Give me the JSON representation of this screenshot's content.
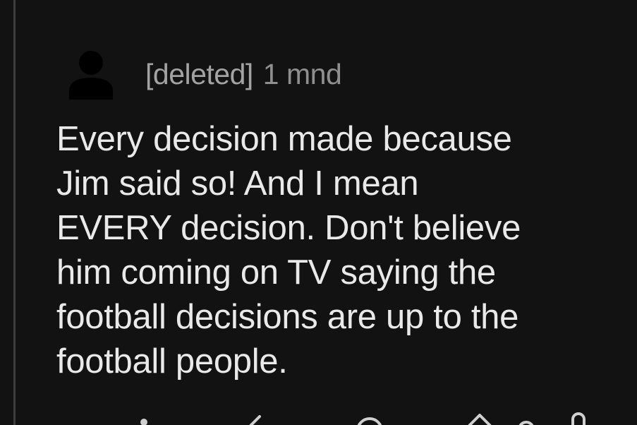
{
  "comment": {
    "author": "[deleted]",
    "time": "1 mnd",
    "body_lines": [
      "Every decision made because",
      "Jim said so! And I mean",
      "EVERY decision. Don't believe",
      "him coming on TV saying the",
      "football decisions are up to the",
      "football people."
    ]
  },
  "actions": {
    "icons": [
      "more-options-icon",
      "reply-icon",
      "award-icon",
      "upvote-icon",
      "vote-count-icon"
    ]
  },
  "colors": {
    "background": "#121212",
    "body_text": "#e9e9e9",
    "meta_text": "#a3a3a3",
    "thread_line": "#3d3d3d",
    "avatar": "#000000"
  }
}
